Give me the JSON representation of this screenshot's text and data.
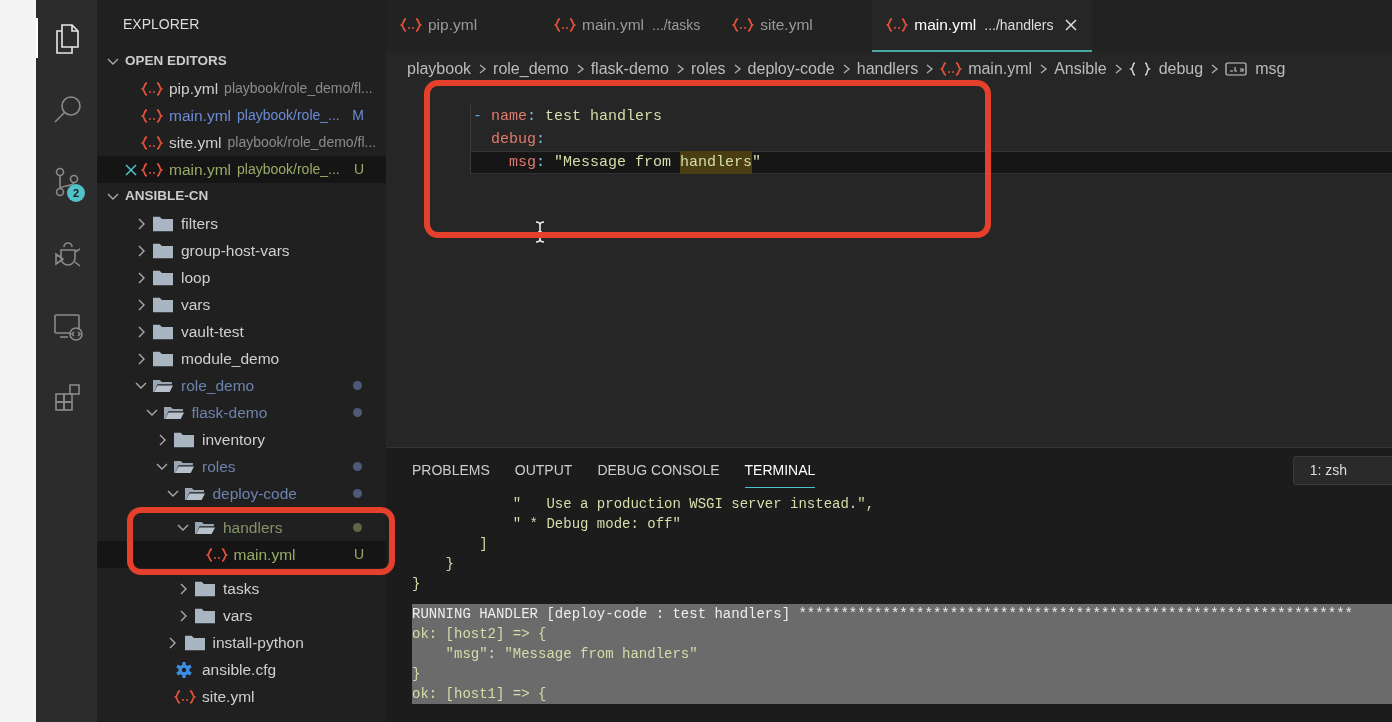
{
  "activity_bar": {
    "items": [
      {
        "selected": true
      },
      {
        "selected": false
      },
      {
        "selected": false,
        "badge": "2"
      },
      {
        "selected": false
      },
      {
        "selected": false
      },
      {
        "selected": false
      }
    ]
  },
  "sidebar": {
    "title": "EXPLORER",
    "open_editors": {
      "title": "OPEN EDITORS",
      "expanded": true,
      "items": [
        {
          "name": "pip.yml",
          "path": "playbook/role_demo/fl...",
          "selected": false
        },
        {
          "name": "main.yml",
          "path": "playbook/role_...",
          "status": "M",
          "color": "#6c8bd5",
          "selected": false
        },
        {
          "name": "site.yml",
          "path": "playbook/role_demo/fl...",
          "selected": false
        },
        {
          "name": "main.yml",
          "path": "playbook/role_...",
          "status": "U",
          "color": "#9aab67",
          "selected": true
        }
      ]
    },
    "workspace": {
      "title": "ANSIBLE-CN",
      "expanded": true,
      "tree": [
        {
          "name": "filters",
          "kind": "folder",
          "expanded": false
        },
        {
          "name": "group-host-vars",
          "kind": "folder",
          "expanded": false
        },
        {
          "name": "loop",
          "kind": "folder",
          "expanded": false
        },
        {
          "name": "vars",
          "kind": "folder",
          "expanded": false
        },
        {
          "name": "vault-test",
          "kind": "folder",
          "expanded": false
        },
        {
          "name": "module_demo",
          "kind": "folder",
          "expanded": false
        },
        {
          "name": "role_demo",
          "kind": "folder",
          "expanded": true,
          "color": "#4c5a76",
          "children": [
            {
              "name": "flask-demo",
              "kind": "folder",
              "expanded": true,
              "color": "#4c5a76",
              "children": [
                {
                  "name": "inventory",
                  "kind": "folder",
                  "expanded": false
                },
                {
                  "name": "roles",
                  "kind": "folder",
                  "expanded": true,
                  "color": "#4c5a76",
                  "children": [
                    {
                      "name": "deploy-code",
                      "kind": "folder",
                      "expanded": true,
                      "color": "#4c5a76",
                      "children": [
                        {
                          "name": "handlers",
                          "kind": "folder",
                          "expanded": true,
                          "color": "#5d6648",
                          "children": [
                            {
                              "name": "main.yml",
                              "kind": "yaml",
                              "status": "U",
                              "color": "#9aab67",
                              "selected": true
                            }
                          ]
                        },
                        {
                          "name": "tasks",
                          "kind": "folder",
                          "expanded": false
                        },
                        {
                          "name": "vars",
                          "kind": "folder",
                          "expanded": false
                        }
                      ]
                    },
                    {
                      "name": "install-python",
                      "kind": "folder",
                      "expanded": false
                    }
                  ]
                },
                {
                  "name": "ansible.cfg",
                  "kind": "config"
                },
                {
                  "name": "site.yml",
                  "kind": "yaml"
                }
              ]
            }
          ]
        }
      ]
    }
  },
  "editor": {
    "tabs": [
      {
        "name": "pip.yml",
        "selected": false
      },
      {
        "name": "main.yml",
        "path": ".../tasks",
        "selected": false
      },
      {
        "name": "site.yml",
        "selected": false
      },
      {
        "name": "main.yml",
        "path": ".../handlers",
        "selected": true
      }
    ],
    "breadcrumb": [
      {
        "text": "playbook",
        "kind": "plain"
      },
      {
        "text": "role_demo",
        "kind": "plain"
      },
      {
        "text": "flask-demo",
        "kind": "plain"
      },
      {
        "text": "roles",
        "kind": "plain"
      },
      {
        "text": "deploy-code",
        "kind": "plain"
      },
      {
        "text": "handlers",
        "kind": "plain"
      },
      {
        "text": "main.yml",
        "kind": "yaml"
      },
      {
        "text": "Ansible",
        "kind": "plain"
      },
      {
        "text": "debug",
        "kind": "object"
      },
      {
        "text": "msg",
        "kind": "string"
      }
    ],
    "code": [
      {
        "current": false,
        "tokens": [
          {
            "text": "- ",
            "kind": "dash"
          },
          {
            "text": "name",
            "kind": "key"
          },
          {
            "text": ": ",
            "kind": "punct"
          },
          {
            "text": "test handlers",
            "kind": "value"
          }
        ],
        "children": [
          {
            "current": false,
            "tokens": [
              {
                "text": "debug",
                "kind": "key"
              },
              {
                "text": ":",
                "kind": "punct"
              }
            ],
            "children": [
              {
                "current": true,
                "tokens": [
                  {
                    "text": "msg",
                    "kind": "key"
                  },
                  {
                    "text": ": ",
                    "kind": "punct"
                  },
                  {
                    "text": "\"Message from ",
                    "kind": "value"
                  },
                  {
                    "text": "handlers",
                    "kind": "value",
                    "highlighted": true
                  },
                  {
                    "text": "\"",
                    "kind": "value"
                  }
                ]
              }
            ]
          }
        ]
      }
    ]
  },
  "panel": {
    "tabs": [
      {
        "label": "PROBLEMS",
        "selected": false
      },
      {
        "label": "OUTPUT",
        "selected": false
      },
      {
        "label": "DEBUG CONSOLE",
        "selected": false
      },
      {
        "label": "TERMINAL",
        "selected": true
      }
    ],
    "terminal_picker": "1: zsh",
    "terminal_lines": [
      {
        "text": "            \"   Use a production WSGI server instead.\",",
        "kind": "output",
        "selected": false
      },
      {
        "text": "            \" * Debug mode: off\"",
        "kind": "output",
        "selected": false
      },
      {
        "text": "        ]",
        "kind": "output",
        "selected": false
      },
      {
        "text": "    }",
        "kind": "output",
        "selected": false
      },
      {
        "text": "}",
        "kind": "output",
        "selected": false
      },
      {
        "text": "RUNNING HANDLER [deploy-code : test handlers] ******************************************************************",
        "kind": "task",
        "selected": true
      },
      {
        "text": "ok: [host2] => {",
        "kind": "output",
        "selected": true
      },
      {
        "text": "    \"msg\": \"Message from handlers\"",
        "kind": "output",
        "selected": true
      },
      {
        "text": "}",
        "kind": "output",
        "selected": true
      },
      {
        "text": "ok: [host1] => {",
        "kind": "output",
        "selected": true
      }
    ]
  }
}
